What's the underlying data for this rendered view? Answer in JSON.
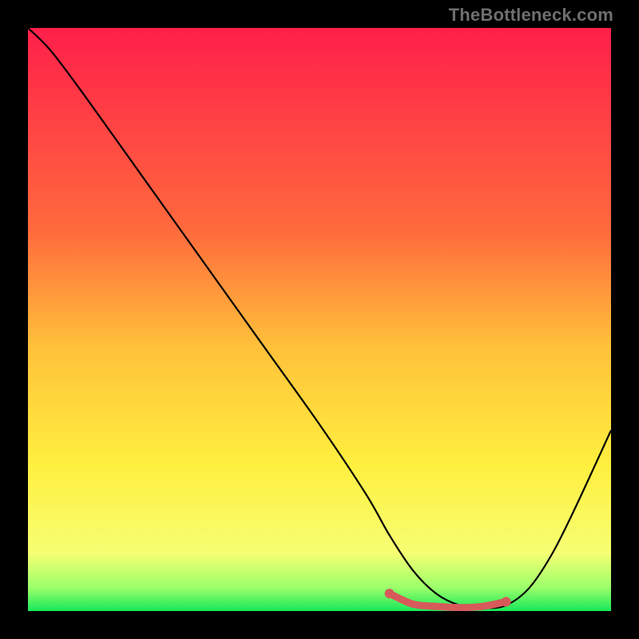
{
  "watermark": "TheBottleneck.com",
  "chart_data": {
    "type": "line",
    "title": "",
    "xlabel": "",
    "ylabel": "",
    "xlim": [
      0,
      100
    ],
    "ylim": [
      0,
      100
    ],
    "grid": false,
    "legend": false,
    "gradient_stops": [
      {
        "offset": 0,
        "color": "#ff1f4a"
      },
      {
        "offset": 35,
        "color": "#ff6b3d"
      },
      {
        "offset": 55,
        "color": "#ffc23a"
      },
      {
        "offset": 75,
        "color": "#ffef3f"
      },
      {
        "offset": 90,
        "color": "#f6ff73"
      },
      {
        "offset": 96,
        "color": "#9bff6a"
      },
      {
        "offset": 100,
        "color": "#17e859"
      }
    ],
    "series": [
      {
        "name": "bottleneck-curve",
        "color": "#000000",
        "x": [
          0,
          4,
          10,
          20,
          30,
          40,
          50,
          58,
          62,
          66,
          70,
          74,
          78,
          82,
          86,
          90,
          94,
          100
        ],
        "y": [
          100,
          96,
          88,
          74,
          60,
          46,
          32,
          20,
          13,
          7,
          3,
          1,
          0.5,
          1,
          4,
          10,
          18,
          31
        ]
      }
    ],
    "highlight": {
      "name": "optimal-flat-region",
      "color": "#d75a5a",
      "x": [
        62,
        66,
        70,
        74,
        78,
        82
      ],
      "y": [
        3.0,
        1.2,
        0.8,
        0.6,
        0.8,
        1.6
      ]
    }
  }
}
